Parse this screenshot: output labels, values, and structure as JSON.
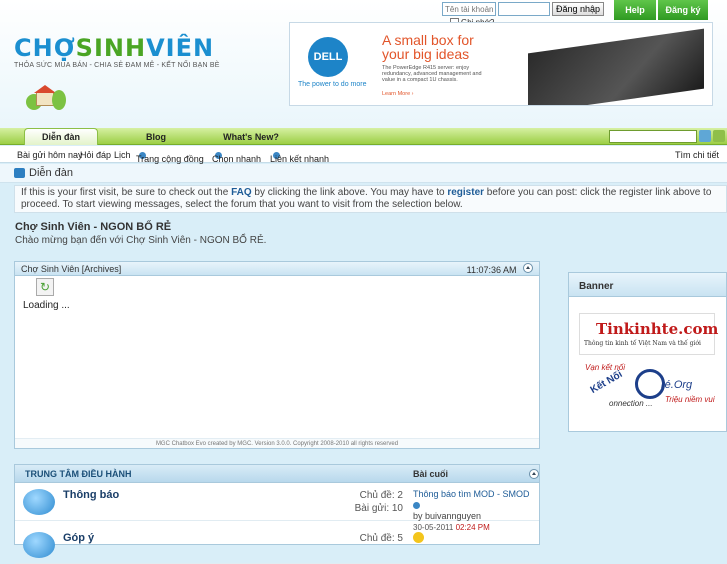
{
  "site": {
    "logo_part1": "CHỢ",
    "logo_part2": "SINH",
    "logo_part3": "VIÊN",
    "tagline": "THỎA SỨC MUA BÁN - CHIA SẺ ĐAM MÊ - KẾT NỐI BẠN BÈ"
  },
  "login": {
    "username_placeholder": "Tên tài khoản",
    "password_value": "",
    "submit_label": "Đăng nhập",
    "remember_label": "Ghi nhớ?"
  },
  "top_buttons": {
    "help": "Help",
    "register": "Đăng ký"
  },
  "ad": {
    "brand": "DELL",
    "brand_sub": "The power to do more",
    "headline_1": "A small box for",
    "headline_2": "your big ideas",
    "body": "The PowerEdge R415 server: enjoy redundancy, advanced management and value in a compact 1U chassis.",
    "more": "Learn More ›"
  },
  "navbar": {
    "tabs": [
      {
        "label": "Diễn đàn"
      },
      {
        "label": "Blog"
      },
      {
        "label": "What's New?"
      }
    ],
    "search_value": ""
  },
  "subnav": {
    "items": [
      "Bài gửi hôm nay",
      "Hỏi đáp",
      "Lịch",
      "Trang cộng đồng",
      "Chọn nhanh",
      "Liên kết nhanh"
    ],
    "advanced_search": "Tìm chi tiết"
  },
  "breadcrumb": {
    "current": "Diễn đàn"
  },
  "notice": {
    "p1": "If this is your first visit, be sure to check out the ",
    "faq": "FAQ",
    "p2": " by clicking the link above. You may have to ",
    "register": "register",
    "p3": " before you can post: click the register link above to proceed. To start viewing messages, select the forum that you want to visit from the selection below."
  },
  "welcome": {
    "title": "Chợ Sinh Viên - NGON BỔ RẺ",
    "subtitle": "Chào mừng bạn đến với Chợ Sinh Viên - NGON BỔ RẺ."
  },
  "chatbox": {
    "title": "Chợ Sinh Viên",
    "archives": "[Archives]",
    "time": "11:07:36 AM",
    "loading": "Loading ...",
    "footer": "MGC Chatbox Evo created by MGC. Version 3.0.0. Copyright 2008-2010 all rights reserved"
  },
  "sidebar": {
    "title": "Banner",
    "banner1_title": "Tinkinhte.com",
    "banner1_sub": "Thông tin kinh tế Việt Nam và thế giới",
    "banner2_line1": "Vạn kết nối",
    "banner2_line2": "Kết Nối",
    "banner2_brand": "ré.Org",
    "banner2_line3": "onnection ...",
    "banner2_line4": "Triệu niềm vui"
  },
  "forum": {
    "section_title": "TRUNG TÂM ĐIỀU HÀNH",
    "last_post_header": "Bài cuối",
    "rows": [
      {
        "name": "Thông báo",
        "threads": "Chủ đề: 2",
        "posts": "Bài gửi: 10",
        "last_title": "Thông báo tìm MOD - SMOD",
        "last_by": "by buivannguyen",
        "last_date": "30-05-2011",
        "last_time": "02:24 PM"
      },
      {
        "name": "Góp ý",
        "threads": "Chủ đề: 5"
      }
    ]
  },
  "colors": {
    "brand_blue": "#1b8fd0",
    "brand_green": "#4aa524",
    "nav_green": "#9ccf45",
    "link_blue": "#1e5c97"
  }
}
